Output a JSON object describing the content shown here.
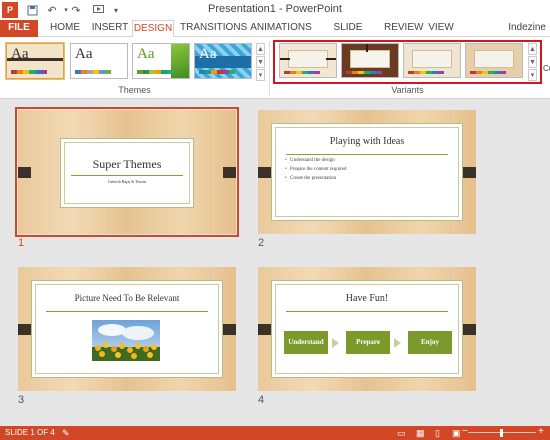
{
  "window": {
    "title": "Presentation1 - PowerPoint",
    "app_icon": "powerpoint-icon",
    "quick_access": [
      "save-icon",
      "undo-icon",
      "redo-icon",
      "start-from-beginning-icon",
      "customize-icon"
    ]
  },
  "tabs": {
    "file": "FILE",
    "home": "HOME",
    "insert": "INSERT",
    "design": "DESIGN",
    "transitions": "TRANSITIONS",
    "animations": "ANIMATIONS",
    "slideshow": "SLIDE SHOW",
    "review": "REVIEW",
    "view": "VIEW",
    "active": "DESIGN"
  },
  "user": {
    "name": "Indezine"
  },
  "ribbon": {
    "themes": {
      "label": "Themes",
      "items": [
        {
          "aa": "Aa",
          "selected": true
        },
        {
          "aa": "Aa"
        },
        {
          "aa": "Aa"
        },
        {
          "aa": "Aa"
        }
      ]
    },
    "variants": {
      "label": "Variants",
      "items": [
        {
          "bg": "#f3e6d2"
        },
        {
          "bg": "#6b3a22"
        },
        {
          "bg": "#efe4cf"
        },
        {
          "bg": "#e6cfa8"
        }
      ]
    },
    "customize_label": "Cu"
  },
  "slides": [
    {
      "number": "1",
      "title": "Super Themes",
      "subtitle": "Geetesh Bajaj & Tenzin",
      "selected": true
    },
    {
      "number": "2",
      "title": "Playing with Ideas",
      "bullets": [
        "Understand the design",
        "Prepare the content required",
        "Create the presentation"
      ]
    },
    {
      "number": "3",
      "title": "Picture Need To Be Relevant"
    },
    {
      "number": "4",
      "title": "Have Fun!",
      "steps": [
        "Understand",
        "Prepare",
        "Enjoy"
      ]
    }
  ],
  "status": {
    "slide_indicator": "SLIDE 1 OF 4"
  },
  "colors": {
    "accent": "#d24726",
    "variants_highlight": "#d3151d",
    "flow_green": "#7b9a2c"
  }
}
